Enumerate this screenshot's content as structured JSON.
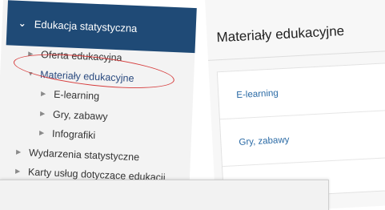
{
  "sidebar": {
    "header": "Edukacja statystyczna",
    "items": [
      {
        "label": "Oferta edukacyjna"
      },
      {
        "label": "Materiały edukacyjne"
      },
      {
        "label": "E-learning"
      },
      {
        "label": "Gry, zabawy"
      },
      {
        "label": "Infografiki"
      },
      {
        "label": "Wydarzenia statystyczne"
      },
      {
        "label": "Karty usług dotyczące edukacji"
      }
    ]
  },
  "content": {
    "title": "Materiały edukacyjne",
    "cards": [
      {
        "label": "E-learning"
      },
      {
        "label": "Gry, zabawy"
      },
      {
        "label": ""
      }
    ]
  },
  "colors": {
    "header_bg": "#1f4a76",
    "highlight": "#d63a3a",
    "link": "#2a6aa5"
  }
}
